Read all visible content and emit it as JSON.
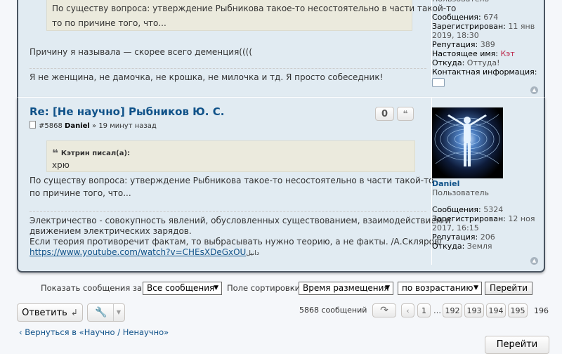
{
  "post1": {
    "quote_text_line1": "По существу вопроса: утверждение Рыбникова такое-то несостоятельно в части такой-то",
    "quote_text_line2": "то по причине того, что...",
    "reply_text": "Причину я называла — скорее всего деменция((((",
    "signature": "Я не женщина, не дамочка, не крошка, не милочка и тд. Я просто собеседник!",
    "profile": {
      "role": "Пользователь",
      "messages_label": "Сообщения:",
      "messages_value": "674",
      "registered_label": "Зарегистрирован:",
      "registered_value": "11 янв 2019, 18:30",
      "reputation_label": "Репутация:",
      "reputation_value": "389",
      "realname_label": "Настоящее имя:",
      "realname_value": "Кэт",
      "from_label": "Откуда:",
      "from_value": "Оттуда!",
      "contact_label": "Контактная информация:"
    }
  },
  "post2": {
    "title": "Re: [Не научно] Рыбников Ю. С.",
    "post_number": "#5868",
    "author": "Daniel",
    "time": "» 19 минут назад",
    "vote_label": "0",
    "quote_button_label": "❝",
    "quote_author": "Кэтрин писал(а):",
    "quote_text": "хрю",
    "body_line1": "По существу вопроса: утверждение Рыбникова такое-то несостоятельно в части такой-то",
    "body_line2": "по причине того, что...",
    "signature_line1": "Электричество - совокупность явлений, обусловленных существованием, взаимодействием и",
    "signature_line2": "движением электрических зарядов.",
    "signature_line3": "Если теория противоречит фактам, то выбрасывать нужно теорию, а не факты. /А.Скляров/",
    "signature_link": "https://www.youtube.com/watch?v=CHEsXDeGxOU",
    "signature_link_suffix": "دانیل",
    "profile": {
      "username": "Daniel",
      "role": "Пользователь",
      "messages_label": "Сообщения:",
      "messages_value": "5324",
      "registered_label": "Зарегистрирован:",
      "registered_value": "12 ноя 2017, 16:15",
      "reputation_label": "Репутация:",
      "reputation_value": "206",
      "from_label": "Откуда:",
      "from_value": "Земля"
    }
  },
  "controls": {
    "show_label": "Показать сообщения за:",
    "show_value": "Все сообщения",
    "sort_label": "Поле сортировки",
    "sort_value": "Время размещения",
    "order_value": "по возрастанию",
    "go_label": "Перейти",
    "reply_button": "Ответить",
    "message_count": "5868 сообщений",
    "pages": [
      "1",
      "192",
      "193",
      "194",
      "195",
      "196"
    ],
    "ellipsis": "…",
    "back_link": "Вернуться в «Научно / Ненаучно»",
    "jump_button": "Перейти"
  },
  "colors": {
    "panel_bg": "#e1ebf2",
    "title_blue": "#105289",
    "quote_bg": "#ebeadd",
    "red_name": "#bc2a4d"
  },
  "icons": [
    "speech-bubble-icon",
    "back-to-top-icon",
    "post-file-icon",
    "quote-mark-icon",
    "reply-arrow-icon",
    "wrench-icon",
    "chevron-down-icon",
    "share-arrow-icon",
    "chevron-left-icon"
  ]
}
